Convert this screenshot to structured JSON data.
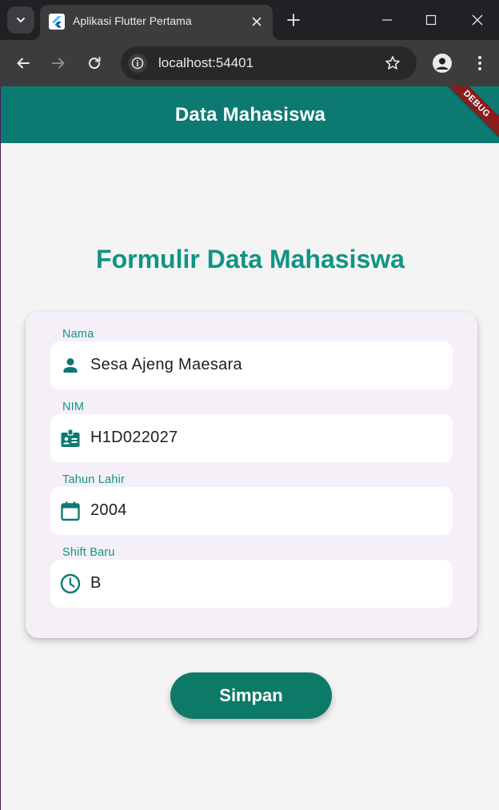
{
  "browser": {
    "tab_title": "Aplikasi Flutter Pertama",
    "url": "localhost:54401"
  },
  "app": {
    "appbar_title": "Data Mahasiswa",
    "debug_banner": "DEBUG",
    "heading": "Formulir Data Mahasiswa",
    "fields": [
      {
        "label": "Nama",
        "value": "Sesa Ajeng Maesara",
        "icon": "person-icon"
      },
      {
        "label": "NIM",
        "value": "H1D022027",
        "icon": "badge-icon"
      },
      {
        "label": "Tahun Lahir",
        "value": "2004",
        "icon": "calendar-icon"
      },
      {
        "label": "Shift Baru",
        "value": "B",
        "icon": "clock-icon"
      }
    ],
    "save_label": "Simpan"
  },
  "colors": {
    "accent": "#0d7a72",
    "heading": "#119484",
    "button": "#0d7a68",
    "debug": "#8a1c1c"
  }
}
